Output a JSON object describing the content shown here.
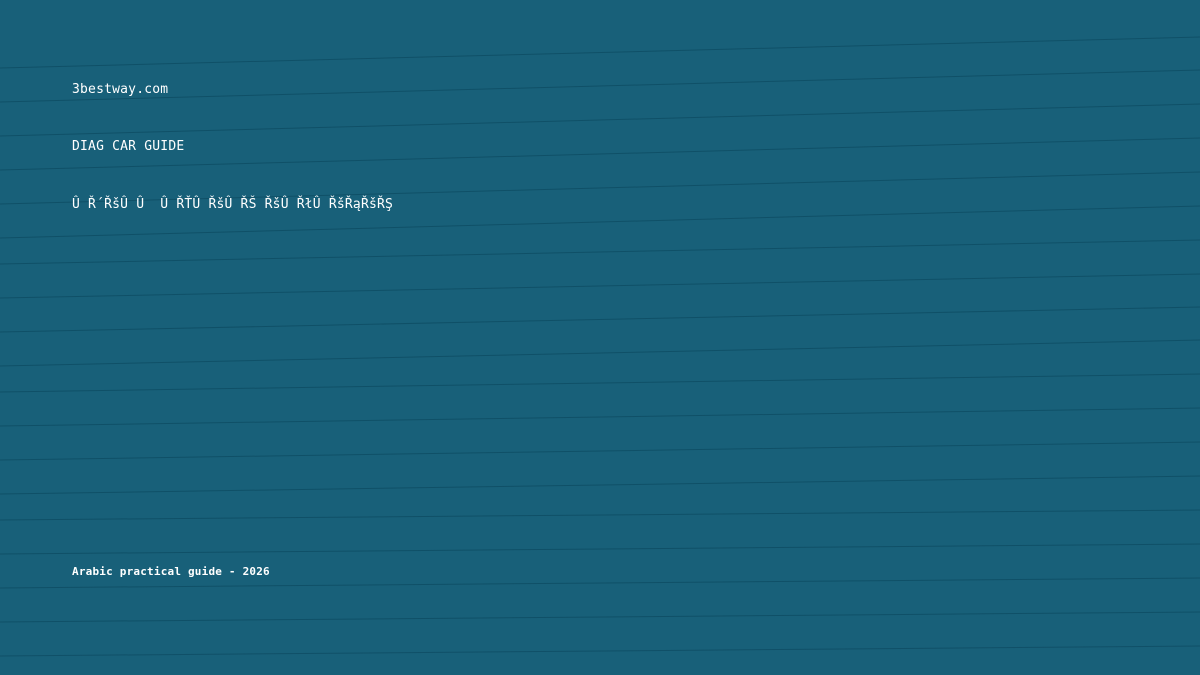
{
  "site": "3bestway.com",
  "title": "DIAG CAR GUIDE",
  "subtitle": "Û Ř´ŘšÛ Û  Û ŘŤÛ ŘšÛ ŘŠ ŘšÛ ŘłÛ ŘšŘąŘšŘŞ",
  "footer": "Arabic practical guide - 2026",
  "colors": {
    "background": "#186079",
    "text": "#ffffff",
    "stripe_line": "#0f4f66"
  }
}
